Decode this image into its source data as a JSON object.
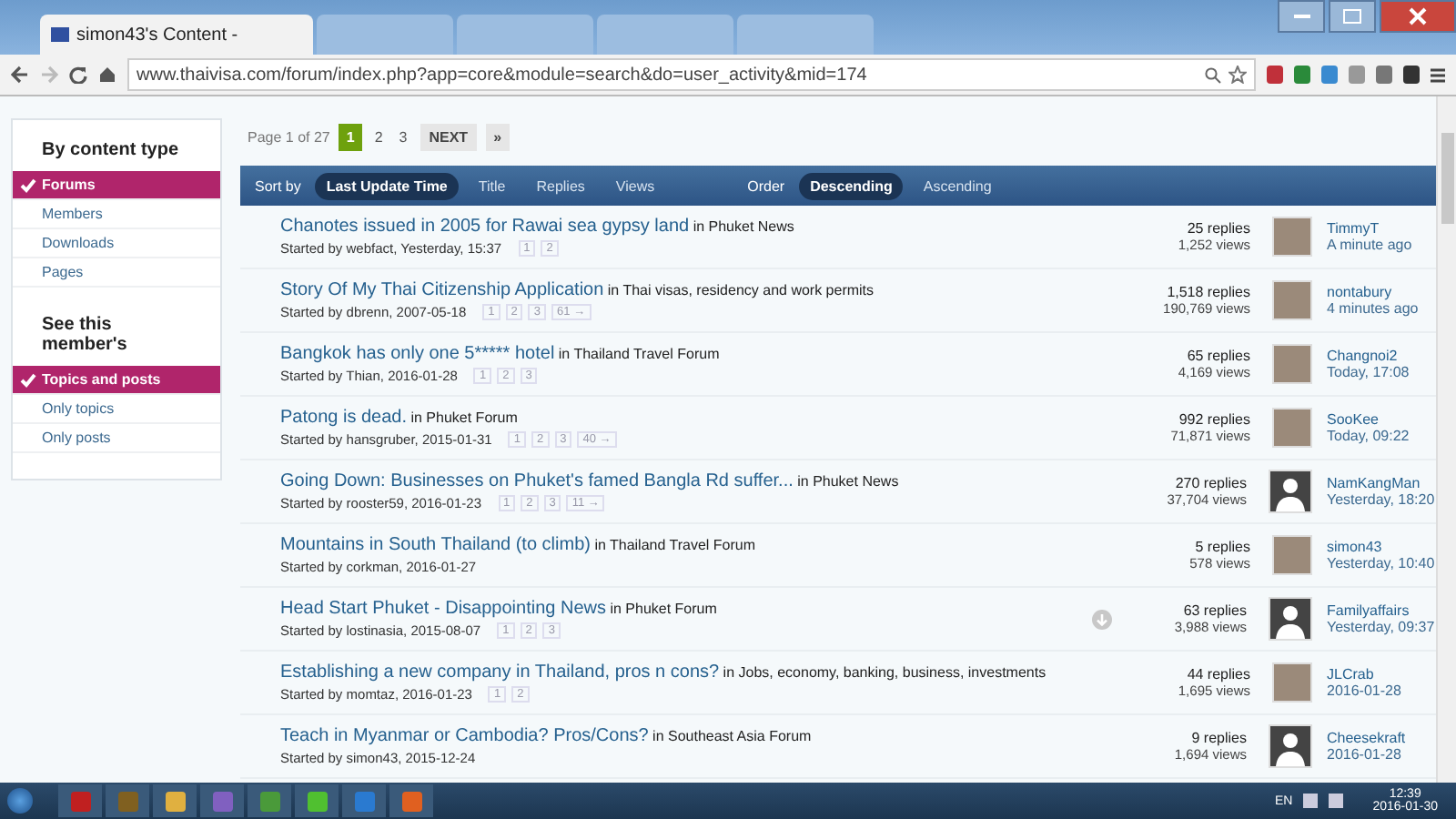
{
  "browser": {
    "tabs": [
      {
        "title": "simon43's Content -",
        "selected": true
      },
      {
        "selected": false
      },
      {
        "selected": false
      },
      {
        "selected": false
      },
      {
        "selected": false
      }
    ],
    "url": "www.thaivisa.com/forum/index.php?app=core&module=search&do=user_activity&mid=174"
  },
  "sidebar": {
    "sections": [
      {
        "heading": "By content type",
        "items": [
          {
            "label": "Forums",
            "selected": true
          },
          {
            "label": "Members",
            "selected": false
          },
          {
            "label": "Downloads",
            "selected": false
          },
          {
            "label": "Pages",
            "selected": false
          }
        ]
      },
      {
        "heading": "See this member's",
        "items": [
          {
            "label": "Topics and posts",
            "selected": true
          },
          {
            "label": "Only topics",
            "selected": false
          },
          {
            "label": "Only posts",
            "selected": false
          }
        ]
      }
    ]
  },
  "pagination": {
    "label": "Page 1 of 27",
    "pages": [
      {
        "label": "1",
        "selected": true
      },
      {
        "label": "2",
        "selected": false
      },
      {
        "label": "3",
        "selected": false
      }
    ],
    "next": "NEXT",
    "last": "»"
  },
  "sort_bar": {
    "sort_label": "Sort by",
    "sort_options": [
      {
        "label": "Last Update Time",
        "selected": true
      },
      {
        "label": "Title",
        "selected": false
      },
      {
        "label": "Replies",
        "selected": false
      },
      {
        "label": "Views",
        "selected": false
      }
    ],
    "order_label": "Order",
    "order_options": [
      {
        "label": "Descending",
        "selected": true
      },
      {
        "label": "Ascending",
        "selected": false
      }
    ]
  },
  "topics": [
    {
      "title": "Chanotes issued in 2005 for Rawai sea gypsy land",
      "forum": "in Phuket News",
      "started": "Started by webfact, Yesterday, 15:37",
      "pages": [
        "1",
        "2"
      ],
      "marker": false,
      "replies": "25 replies",
      "views": "1,252 views",
      "avatar": {
        "kind": "photo"
      },
      "poster": "TimmyT",
      "time": "A minute ago"
    },
    {
      "title": "Story Of My Thai Citizenship Application",
      "forum": "in Thai visas, residency and work permits",
      "started": "Started by dbrenn, 2007-05-18",
      "pages": [
        "1",
        "2",
        "3",
        "61 →"
      ],
      "marker": false,
      "replies": "1,518 replies",
      "views": "190,769 views",
      "avatar": {
        "kind": "photo"
      },
      "poster": "nontabury",
      "time": "4 minutes ago"
    },
    {
      "title": "Bangkok has only one 5***** hotel",
      "forum": "in Thailand Travel Forum",
      "started": "Started by Thian, 2016-01-28",
      "pages": [
        "1",
        "2",
        "3"
      ],
      "marker": false,
      "replies": "65 replies",
      "views": "4,169 views",
      "avatar": {
        "kind": "photo"
      },
      "poster": "Changnoi2",
      "time": "Today, 17:08"
    },
    {
      "title": "Patong is dead.",
      "forum": "in Phuket Forum",
      "started": "Started by hansgruber, 2015-01-31",
      "pages": [
        "1",
        "2",
        "3",
        "40 →"
      ],
      "marker": false,
      "replies": "992 replies",
      "views": "71,871 views",
      "avatar": {
        "kind": "photo"
      },
      "poster": "SooKee",
      "time": "Today, 09:22"
    },
    {
      "title": "Going Down: Businesses on Phuket's famed Bangla Rd suffer...",
      "forum": "in Phuket News",
      "started": "Started by rooster59, 2016-01-23",
      "pages": [
        "1",
        "2",
        "3",
        "11 →"
      ],
      "marker": false,
      "replies": "270 replies",
      "views": "37,704 views",
      "avatar": {
        "kind": "silhouette"
      },
      "poster": "NamKangMan",
      "time": "Yesterday, 18:20"
    },
    {
      "title": "Mountains in South Thailand (to climb)",
      "forum": "in Thailand Travel Forum",
      "started": "Started by corkman, 2016-01-27",
      "marker": false,
      "replies": "5 replies",
      "views": "578 views",
      "avatar": {
        "kind": "photo"
      },
      "poster": "simon43",
      "time": "Yesterday, 10:40"
    },
    {
      "title": "Head Start Phuket - Disappointing News",
      "forum": "in Phuket Forum",
      "started": "Started by lostinasia, 2015-08-07",
      "pages": [
        "1",
        "2",
        "3"
      ],
      "marker": true,
      "replies": "63 replies",
      "views": "3,988 views",
      "avatar": {
        "kind": "silhouette"
      },
      "poster": "Familyaffairs",
      "time": "Yesterday, 09:37"
    },
    {
      "title": "Establishing a new company in Thailand, pros n cons?",
      "forum": "in Jobs, economy, banking, business, investments",
      "started": "Started by momtaz, 2016-01-23",
      "pages": [
        "1",
        "2"
      ],
      "marker": false,
      "replies": "44 replies",
      "views": "1,695 views",
      "avatar": {
        "kind": "photo"
      },
      "poster": "JLCrab",
      "time": "2016-01-28"
    },
    {
      "title": "Teach in Myanmar or Cambodia? Pros/Cons?",
      "forum": "in Southeast Asia Forum",
      "started": "Started by simon43, 2015-12-24",
      "marker": false,
      "replies": "9 replies",
      "views": "1,694 views",
      "avatar": {
        "kind": "silhouette"
      },
      "poster": "Cheesekraft",
      "time": "2016-01-28"
    }
  ],
  "taskbar": {
    "language": "EN",
    "time": "12:39",
    "date": "2016-01-30"
  }
}
